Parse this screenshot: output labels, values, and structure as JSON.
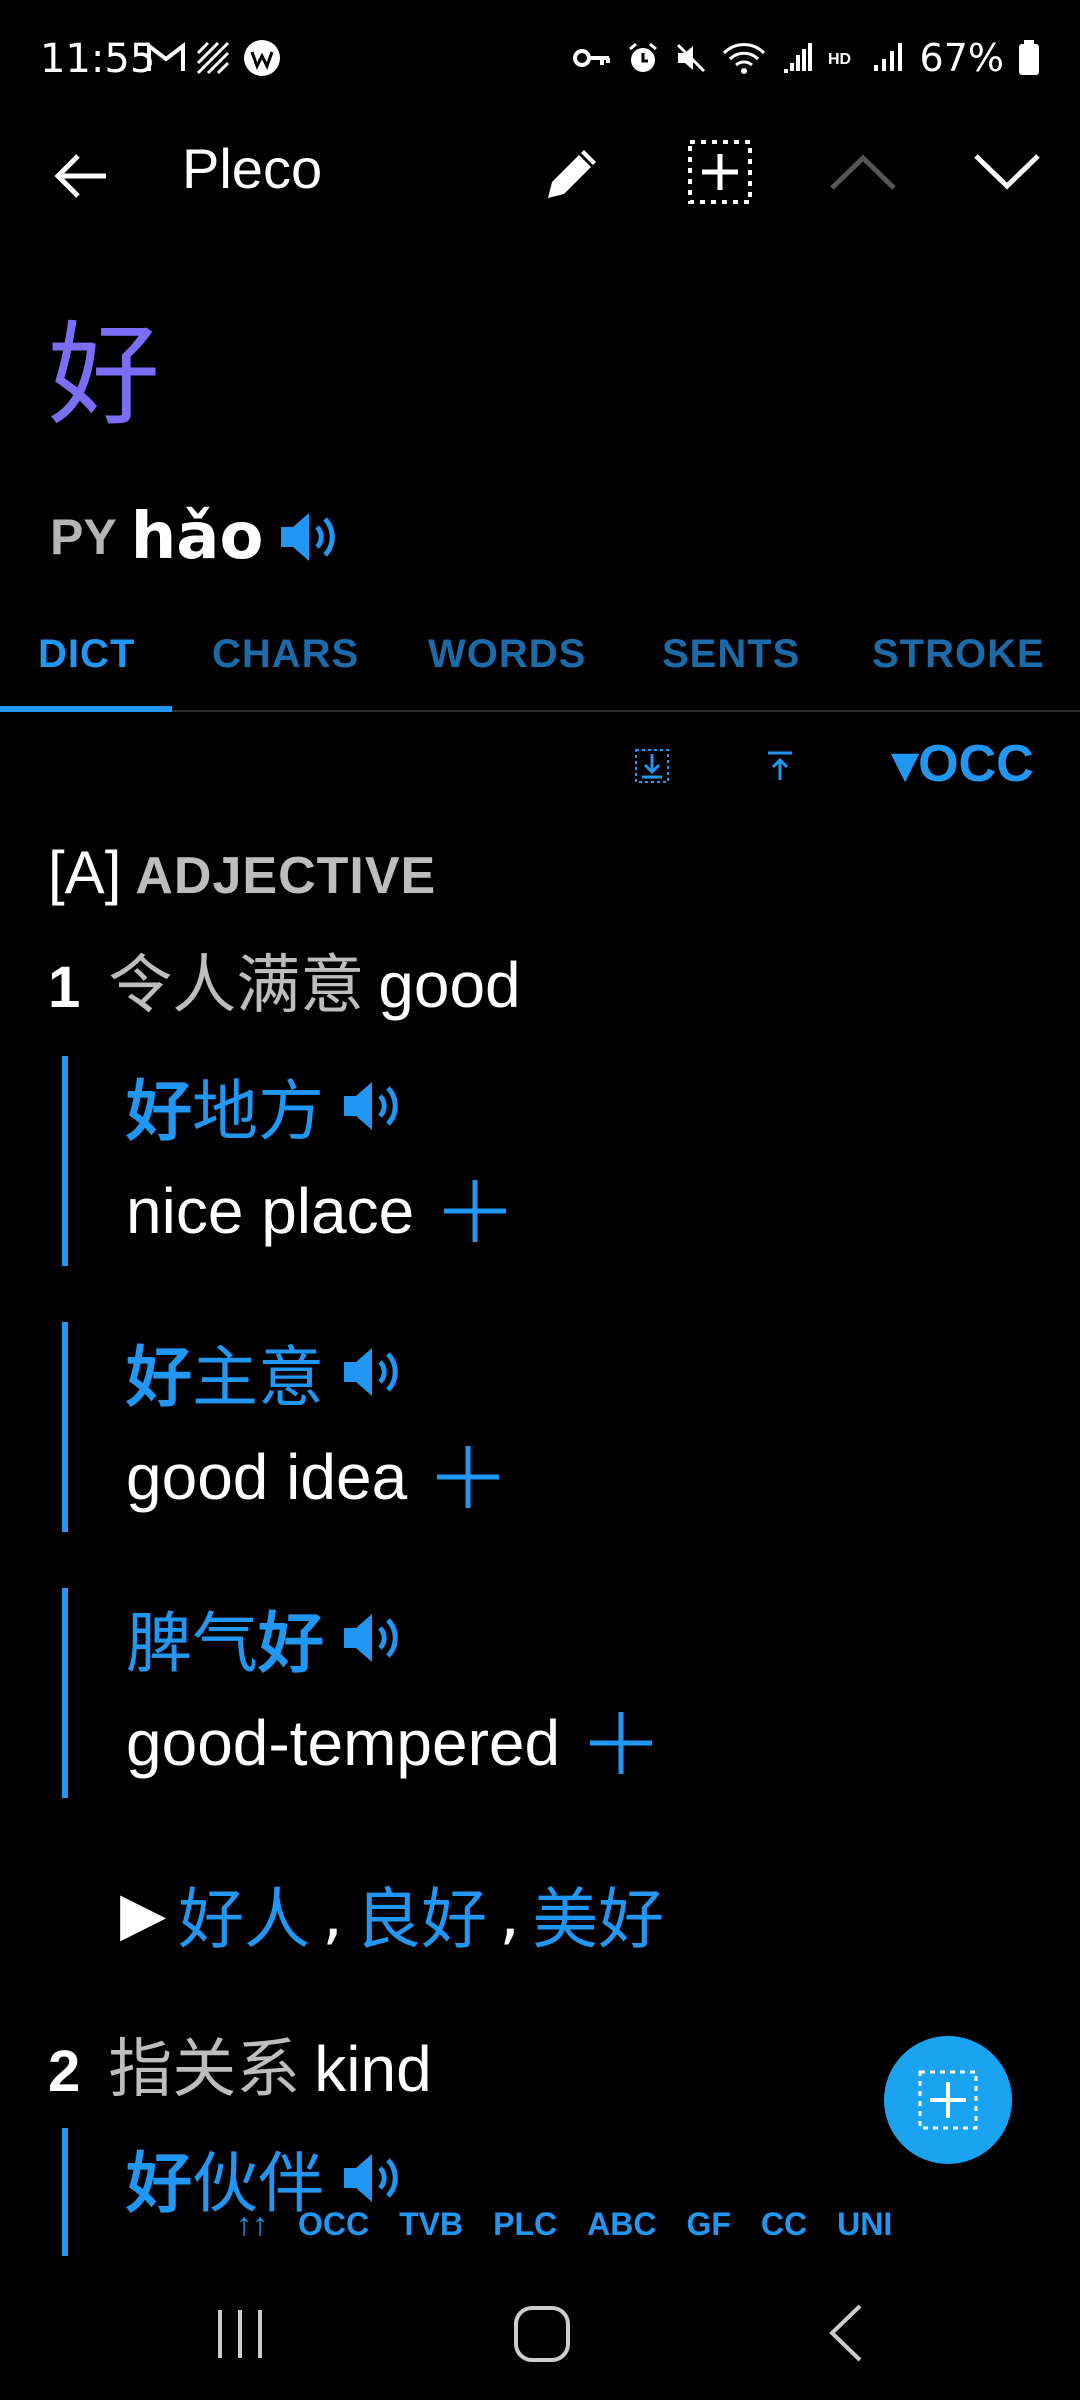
{
  "status": {
    "time": "11:55",
    "battery_percent": "67%"
  },
  "appbar": {
    "title": "Pleco"
  },
  "entry": {
    "headword": "好",
    "pinyin_label": "PY",
    "pinyin": "hǎo"
  },
  "tabs": [
    {
      "label": "DICT",
      "active": true
    },
    {
      "label": "CHARS",
      "active": false
    },
    {
      "label": "WORDS",
      "active": false
    },
    {
      "label": "SENTS",
      "active": false
    },
    {
      "label": "STROKE",
      "active": false
    }
  ],
  "toolbar": {
    "occ_label": "▾OCC"
  },
  "definition": {
    "pos_bracket": "[A]",
    "pos_name": "ADJECTIVE",
    "senses": [
      {
        "num": "1",
        "cn": "令人满意",
        "en": "good",
        "examples": [
          {
            "bold": "好",
            "rest": "地方",
            "rest_before": "",
            "en": "nice place"
          },
          {
            "bold": "好",
            "rest": "主意",
            "rest_before": "",
            "en": "good idea"
          },
          {
            "bold": "好",
            "rest": "",
            "rest_before": "脾气",
            "en": "good-tempered"
          }
        ],
        "see_also": [
          "好人",
          "良好",
          "美好"
        ]
      },
      {
        "num": "2",
        "cn": "指关系",
        "en": "kind",
        "examples": [
          {
            "bold": "好",
            "rest": "伙伴",
            "rest_before": ""
          }
        ]
      }
    ]
  },
  "dict_bar": {
    "arrows": "↑↑",
    "items": [
      "OCC",
      "TVB",
      "PLC",
      "ABC",
      "GF",
      "CC",
      "UNI"
    ]
  },
  "colors": {
    "accent": "#2196f3",
    "headword": "#7b6ef6",
    "fab": "#1aa3f0"
  }
}
